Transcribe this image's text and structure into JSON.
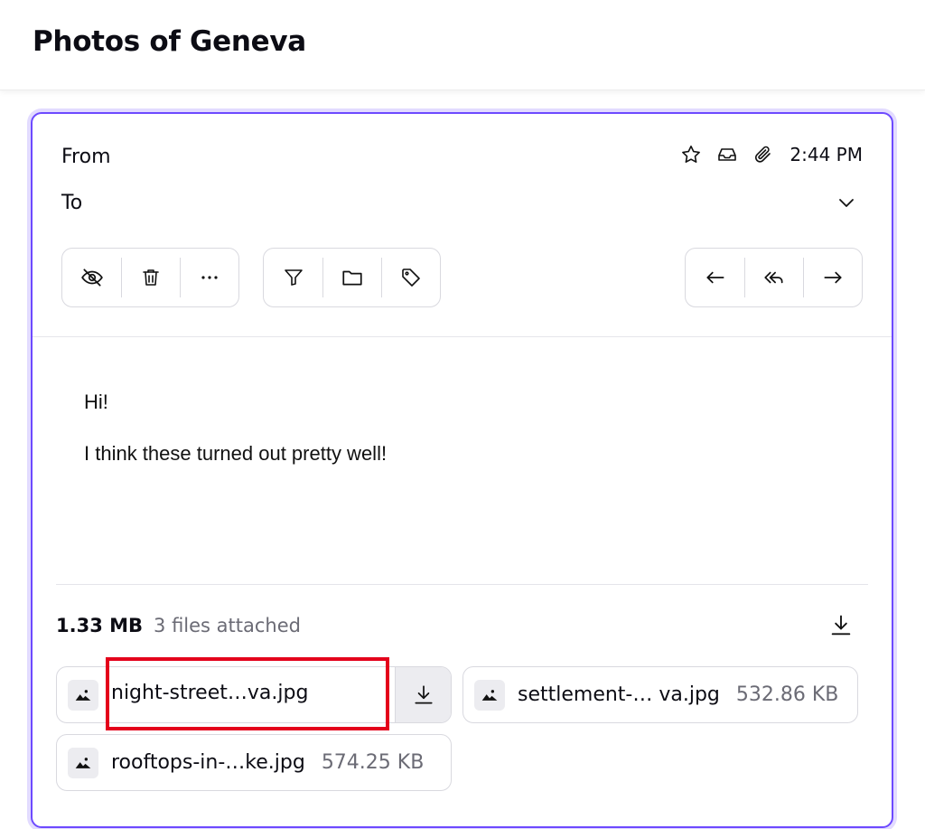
{
  "subject": "Photos of Geneva",
  "header": {
    "from_label": "From",
    "to_label": "To",
    "time": "2:44 PM",
    "icons": [
      "star-icon",
      "inbox-icon",
      "paperclip-icon",
      "chevron-down-icon"
    ]
  },
  "toolbar": {
    "group1": [
      "eye-off-icon",
      "trash-icon",
      "more-icon"
    ],
    "group2": [
      "filter-icon",
      "folder-icon",
      "tag-icon"
    ],
    "group3": [
      "reply-icon",
      "reply-all-icon",
      "forward-icon"
    ]
  },
  "body": {
    "greeting": "Hi!",
    "line": "I think these turned out pretty well!"
  },
  "attachments": {
    "total_size": "1.33 MB",
    "count_text": "3 files attached",
    "items": [
      {
        "name": "night-street…va.jpg",
        "size": ""
      },
      {
        "name": "settlement-… va.jpg",
        "size": "532.86 KB"
      },
      {
        "name": "rooftops-in-…ke.jpg",
        "size": "574.25 KB"
      }
    ]
  },
  "colors": {
    "accent": "#6d4aff",
    "highlight": "#e4001b"
  }
}
